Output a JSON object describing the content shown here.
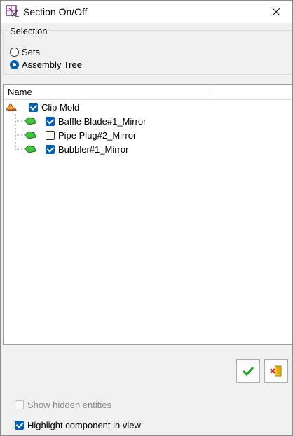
{
  "window": {
    "title": "Section On/Off"
  },
  "selection": {
    "legend": "Selection",
    "options": [
      {
        "label": "Sets",
        "selected": false
      },
      {
        "label": "Assembly Tree",
        "selected": true
      }
    ]
  },
  "tree": {
    "column_header": "Name",
    "root": {
      "label": "Clip Mold",
      "checked": true
    },
    "children": [
      {
        "label": "Baffle Blade#1_Mirror",
        "checked": true
      },
      {
        "label": "Pipe Plug#2_Mirror",
        "checked": false
      },
      {
        "label": "Bubbler#1_Mirror",
        "checked": true
      }
    ]
  },
  "options": {
    "show_hidden": {
      "label": "Show hidden entities",
      "checked": false,
      "enabled": false
    },
    "highlight": {
      "label": "Highlight component in view",
      "checked": true,
      "enabled": true
    }
  },
  "colors": {
    "accent": "#005fb8",
    "ok_green": "#1ea51e",
    "assembly_orange": "#f0a030",
    "part_green": "#3cc83c"
  }
}
